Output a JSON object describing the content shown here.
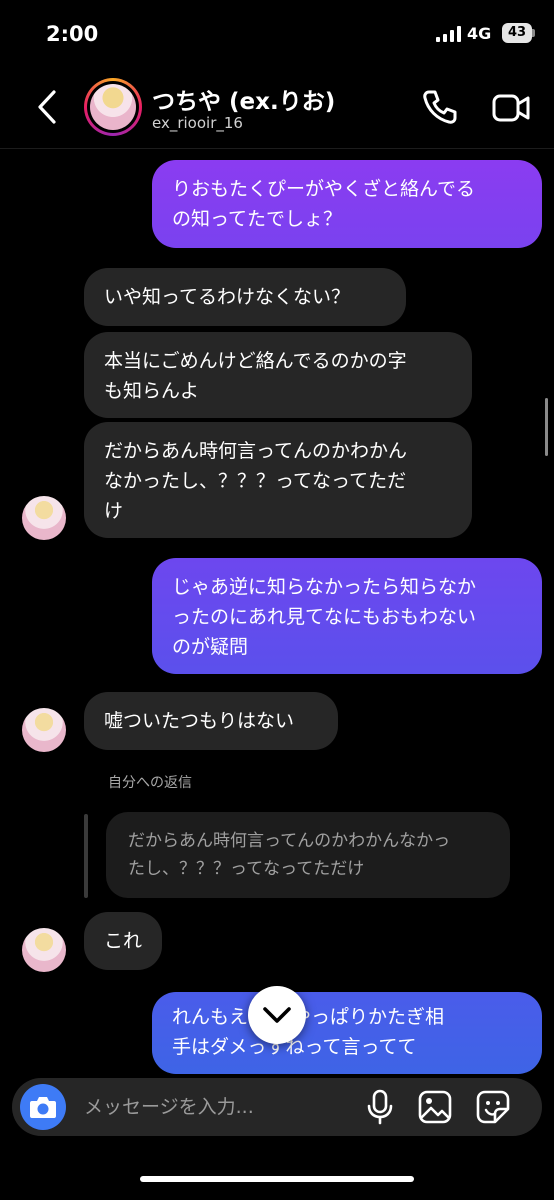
{
  "status_bar": {
    "time": "2:00",
    "network": "4G",
    "battery": "43"
  },
  "header": {
    "name": "つちや (ex.りお)",
    "username": "ex_riooir_16"
  },
  "messages": [
    {
      "lines": [
        "りおもたくぴーがやくざと絡んでる",
        "の知ってたでしょ？"
      ]
    },
    {
      "lines": [
        "いや知ってるわけなくない？"
      ]
    },
    {
      "lines": [
        "本当にごめんけど絡んでるのかの字",
        "も知らんよ"
      ]
    },
    {
      "lines": [
        "だからあん時何言ってんのかわかん",
        "なかったし、？？？ってなってただ",
        "け"
      ]
    },
    {
      "lines": [
        "じゃあ逆に知らなかったら知らなか",
        "ったのにあれ見てなにもおもわない",
        "のが疑問"
      ]
    },
    {
      "lines": [
        "嘘ついたつもりはない"
      ]
    },
    {
      "lines": [
        "これ"
      ]
    },
    {
      "lines": [
        "れんもえ    んにやっぱりかたぎ相",
        "手はダメっすねって言ってて"
      ]
    }
  ],
  "reply": {
    "label": "自分への返信",
    "lines": [
      "だからあん時何言ってんのかわかんなかっ",
      "たし、？？？ってなってただけ"
    ]
  },
  "composer": {
    "placeholder": "メッセージを入力..."
  },
  "colors": {
    "sent_top": "#8a3bf0",
    "sent_mid": "#6a48ee",
    "sent_bottom": "#3f62e6",
    "received": "#262626",
    "camera": "#3e7bf6"
  }
}
